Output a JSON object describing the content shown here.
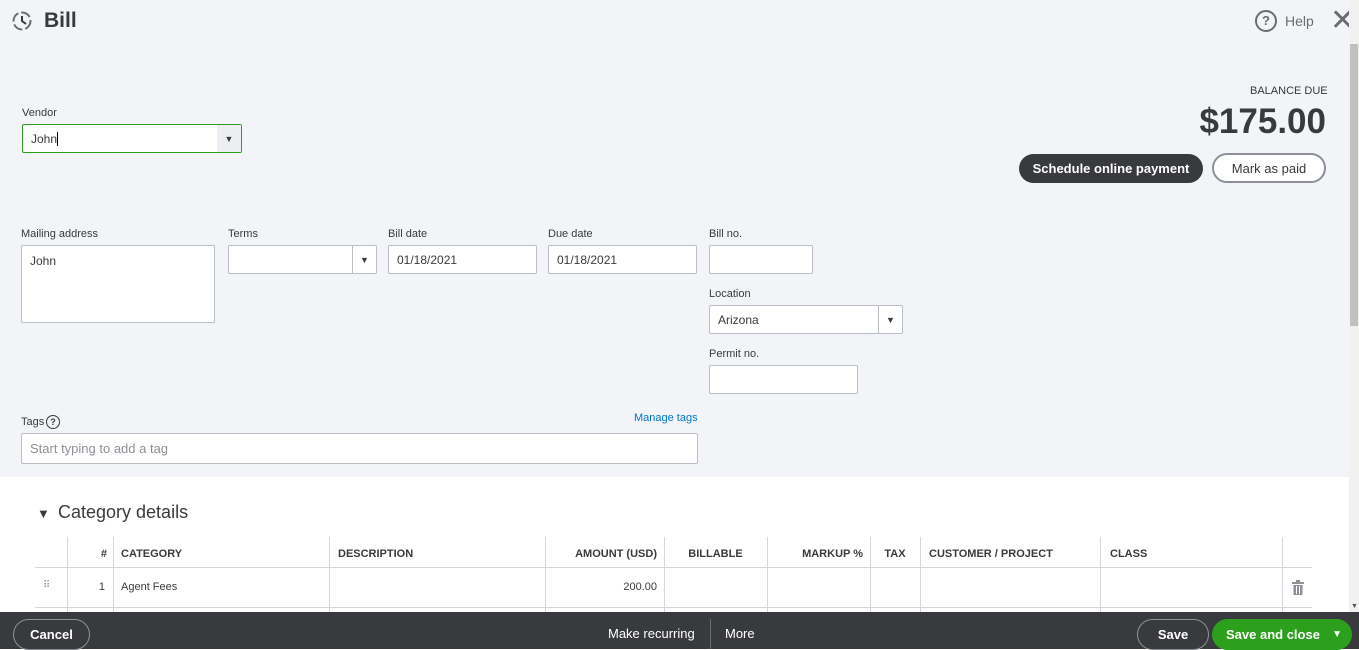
{
  "header": {
    "title": "Bill",
    "help": "Help"
  },
  "balance": {
    "label": "BALANCE DUE",
    "amount": "$175.00",
    "schedule": "Schedule online payment",
    "mark_paid": "Mark as paid"
  },
  "form": {
    "vendor_label": "Vendor",
    "vendor": "John",
    "mailing_label": "Mailing address",
    "mailing": "John",
    "terms_label": "Terms",
    "terms": "",
    "bill_date_label": "Bill date",
    "bill_date": "01/18/2021",
    "due_date_label": "Due date",
    "due_date": "01/18/2021",
    "bill_no_label": "Bill no.",
    "bill_no": "",
    "location_label": "Location",
    "location": "Arizona",
    "permit_label": "Permit no.",
    "permit": "",
    "tags_label": "Tags",
    "manage_tags": "Manage tags",
    "tags_placeholder": "Start typing to add a tag"
  },
  "category": {
    "title": "Category details",
    "columns": [
      "#",
      "CATEGORY",
      "DESCRIPTION",
      "AMOUNT (USD)",
      "BILLABLE",
      "MARKUP %",
      "TAX",
      "CUSTOMER / PROJECT",
      "CLASS"
    ],
    "rows": [
      {
        "num": "1",
        "category": "Agent Fees",
        "description": "",
        "amount": "200.00"
      }
    ]
  },
  "footer": {
    "cancel": "Cancel",
    "recurring": "Make recurring",
    "more": "More",
    "save": "Save",
    "save_close": "Save and close"
  }
}
